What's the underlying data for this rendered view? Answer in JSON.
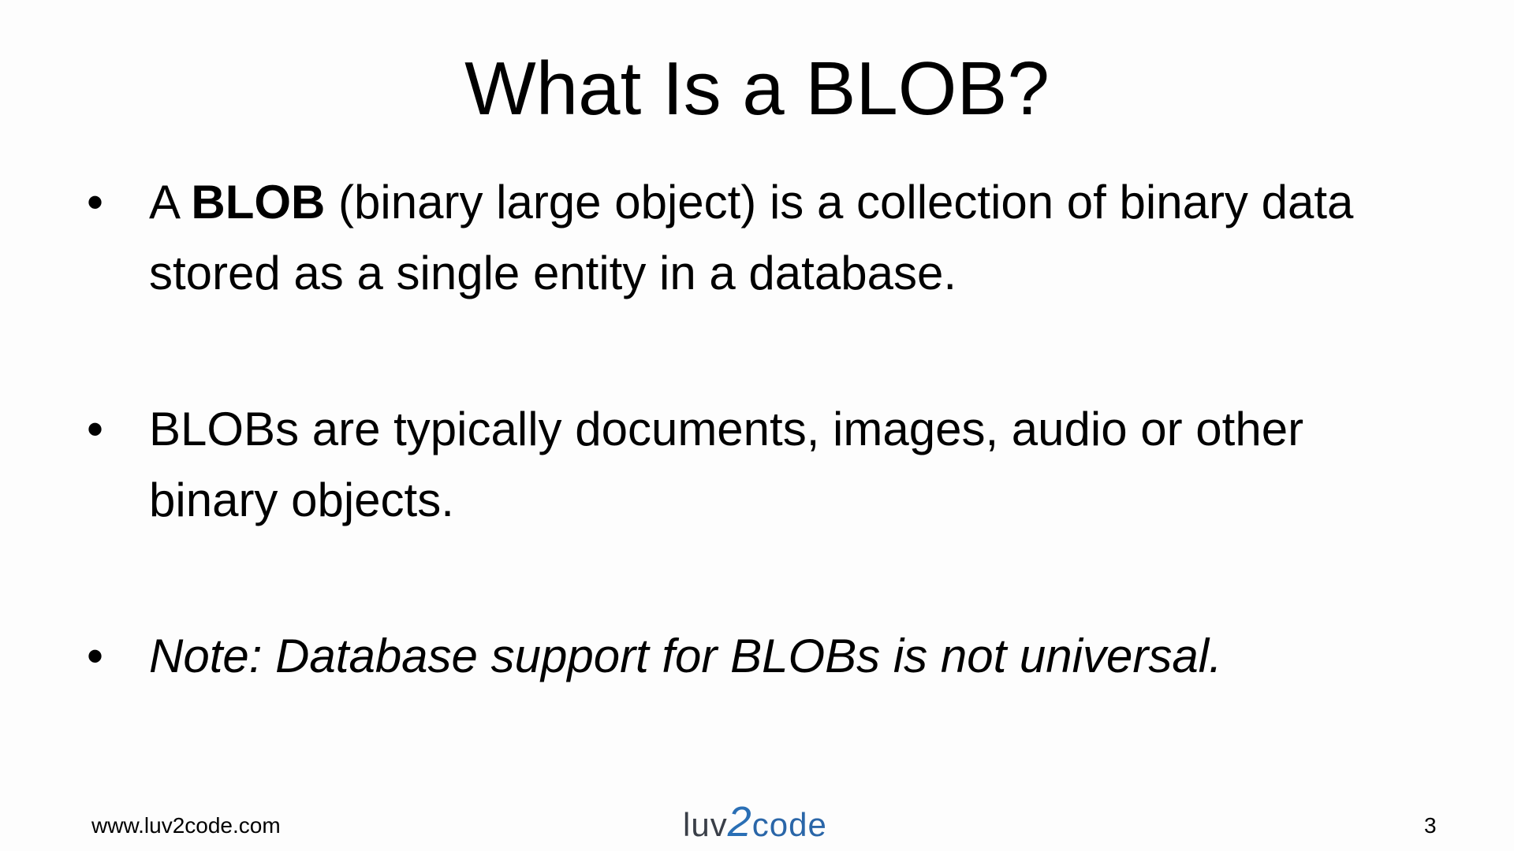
{
  "slide": {
    "title": "What Is a BLOB?",
    "bullets": [
      {
        "prefix": "A ",
        "bold": "BLOB",
        "text": " (binary large object) is a collection of binary data stored as a single entity in a database."
      },
      {
        "text": "BLOBs are typically documents, images, audio or other binary objects."
      },
      {
        "text": "Note: Database support for BLOBs is not universal."
      }
    ],
    "bullet_glyph": "•"
  },
  "footer": {
    "url": "www.luv2code.com",
    "logo": {
      "part1": "luv",
      "part2": "2",
      "part3": "code"
    },
    "page_number": "3"
  }
}
